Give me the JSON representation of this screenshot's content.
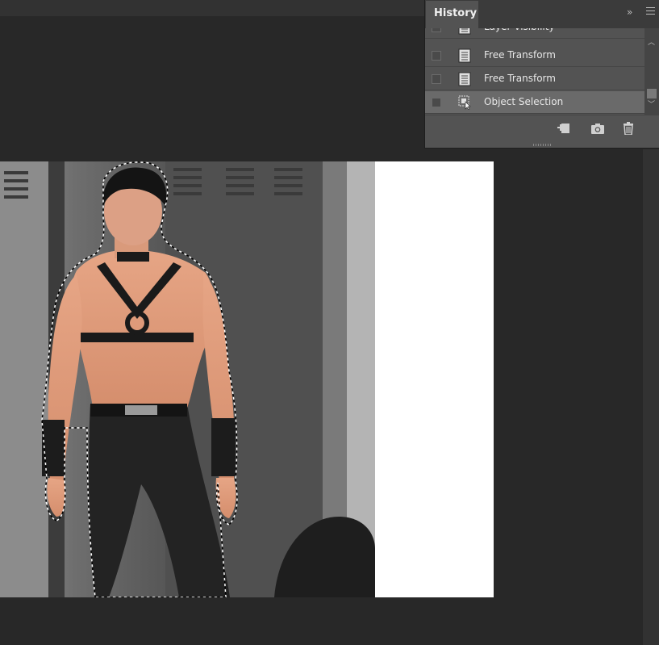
{
  "history_panel": {
    "tab_label": "History",
    "collapse_glyph": "»",
    "items": [
      {
        "label": "Layer Visibility",
        "icon": "document-icon",
        "selected": false
      },
      {
        "label": "Free Transform",
        "icon": "document-icon",
        "selected": false
      },
      {
        "label": "Free Transform",
        "icon": "document-icon",
        "selected": false
      },
      {
        "label": "Object Selection",
        "icon": "object-selection-icon",
        "selected": true
      }
    ],
    "footer_icons": [
      "new-document-from-state-icon",
      "snapshot-camera-icon",
      "trash-icon"
    ]
  },
  "colors": {
    "workspace": "#282828",
    "panel": "#535353",
    "selected_row": "#6a6a6a",
    "canvas_blank": "#ffffff"
  }
}
